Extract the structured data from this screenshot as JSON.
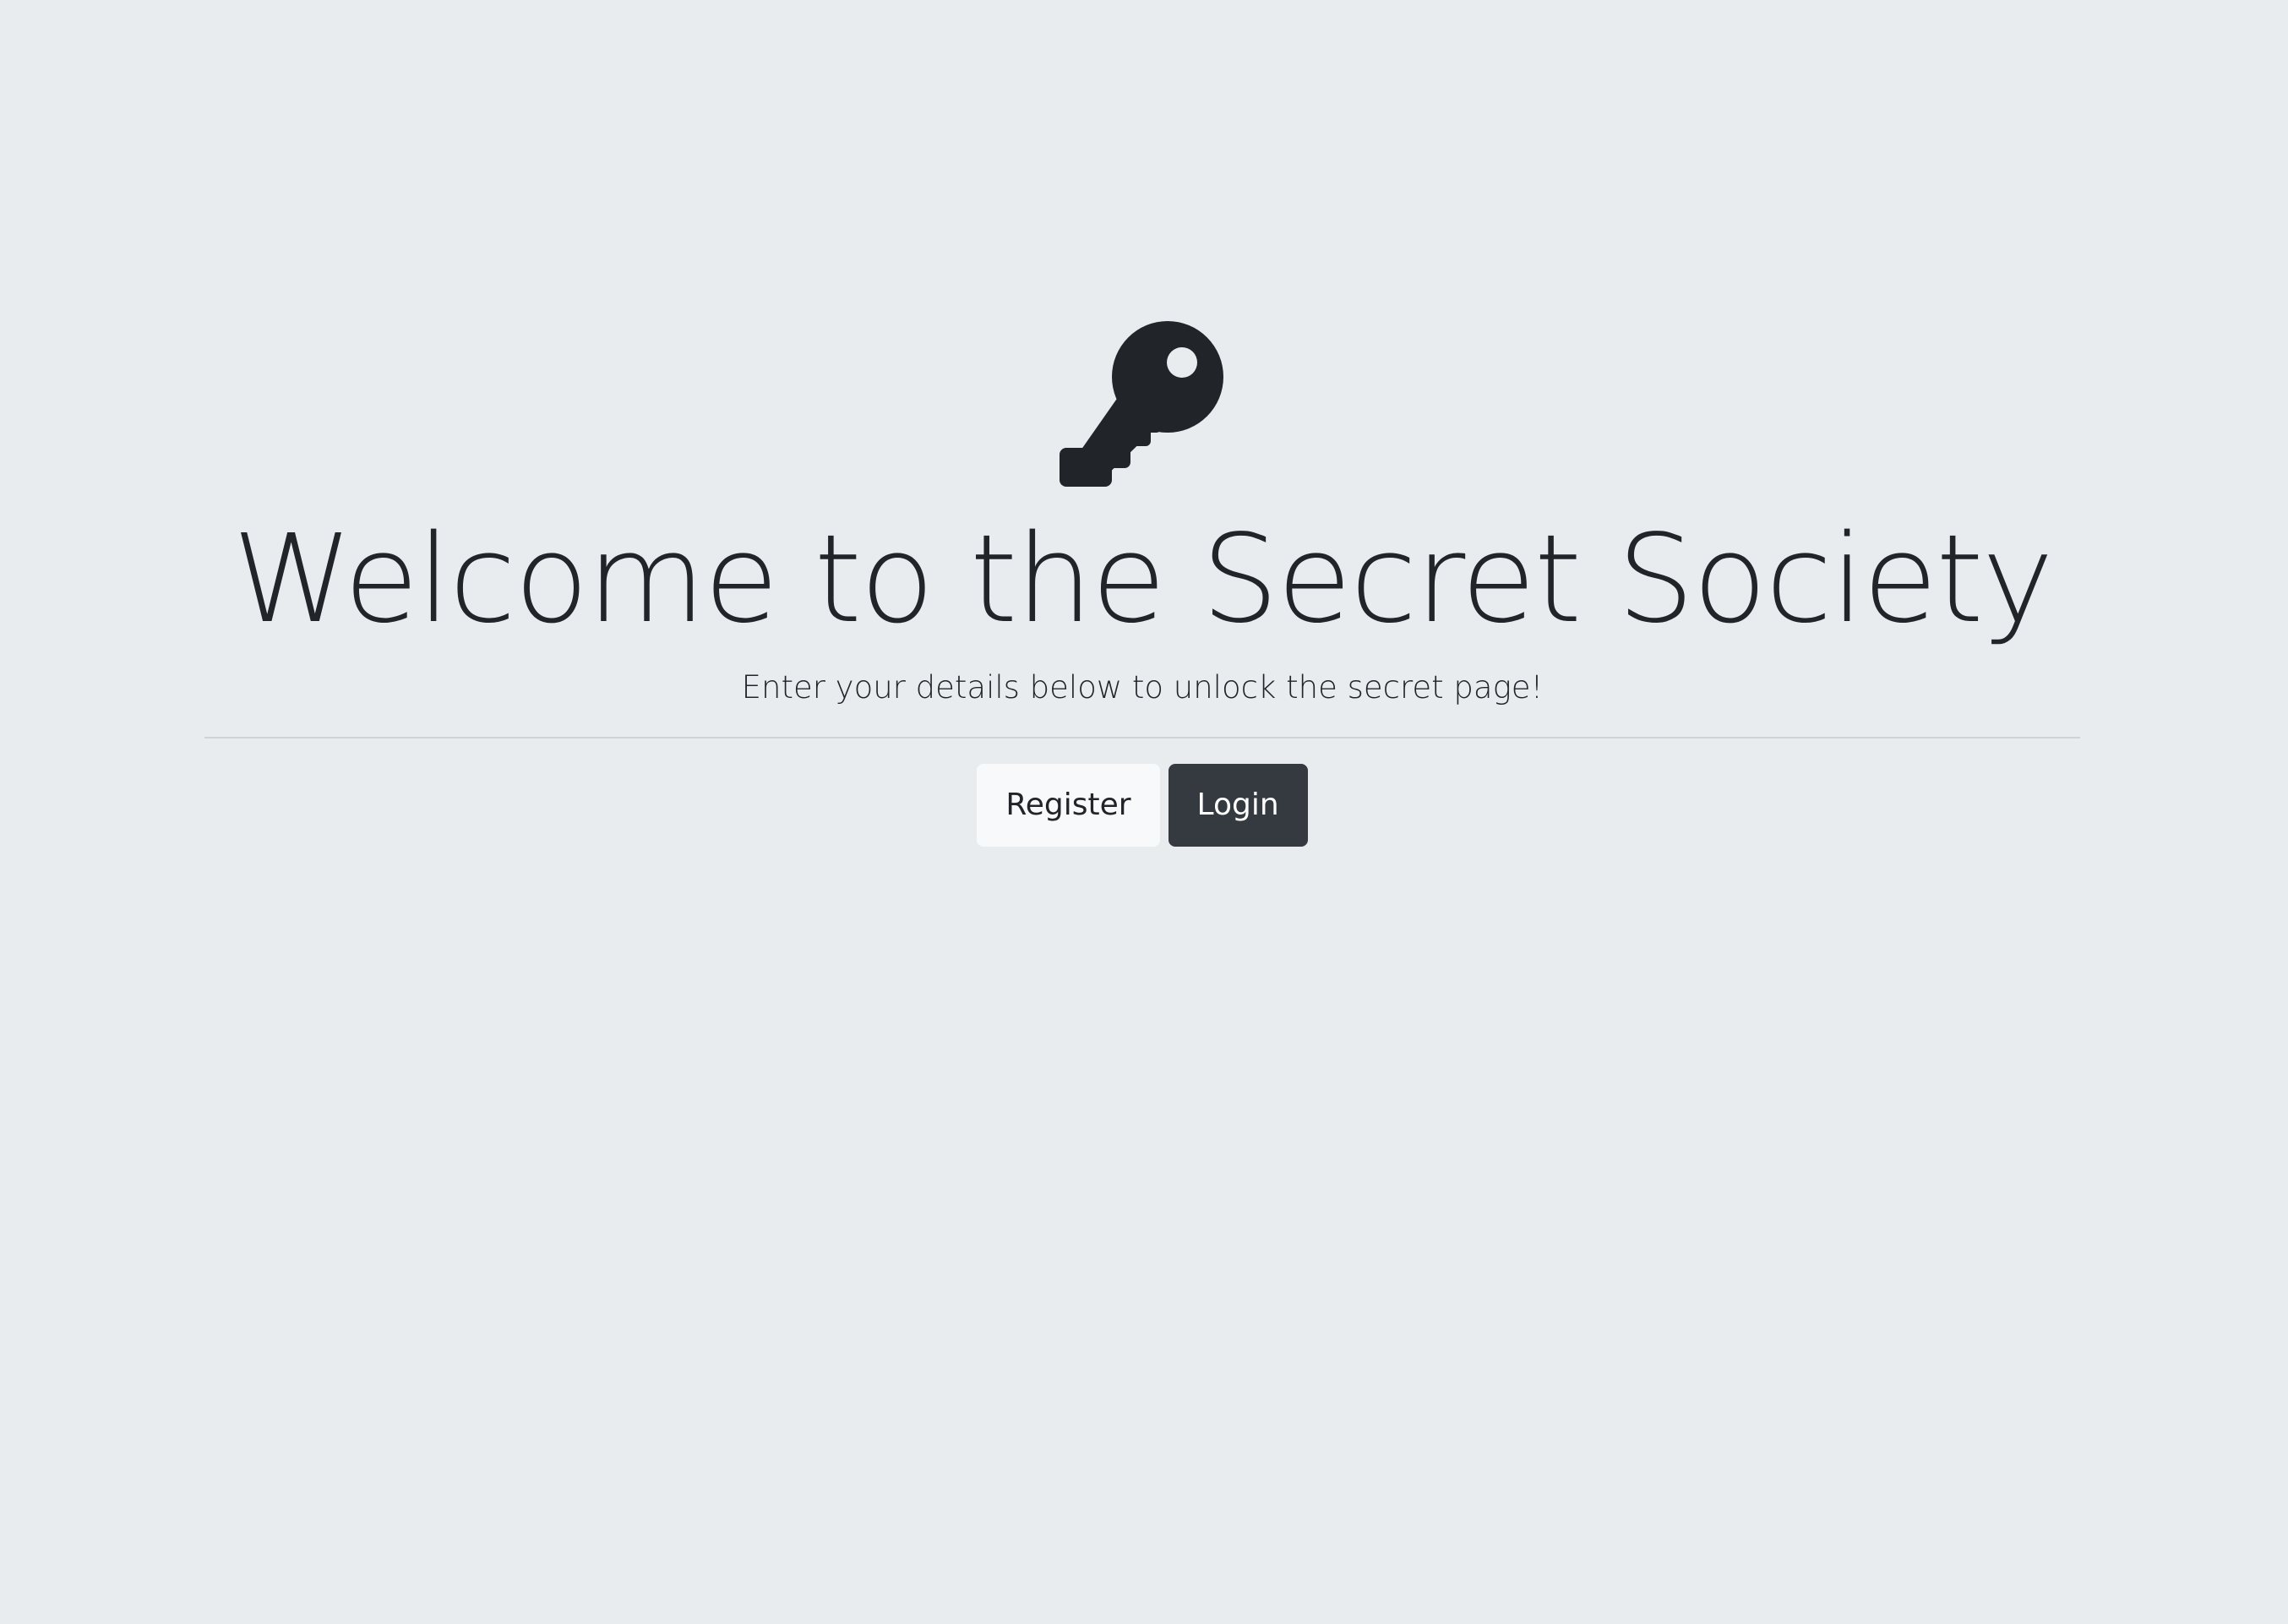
{
  "hero": {
    "icon": "key-icon",
    "title": "Welcome to the Secret Society",
    "lead": "Enter your details below to unlock the secret page!"
  },
  "actions": {
    "register_label": "Register",
    "login_label": "Login"
  },
  "colors": {
    "background": "#e9ecef",
    "text": "#212529",
    "button_light": "#f8f9fa",
    "button_dark": "#343a40"
  }
}
